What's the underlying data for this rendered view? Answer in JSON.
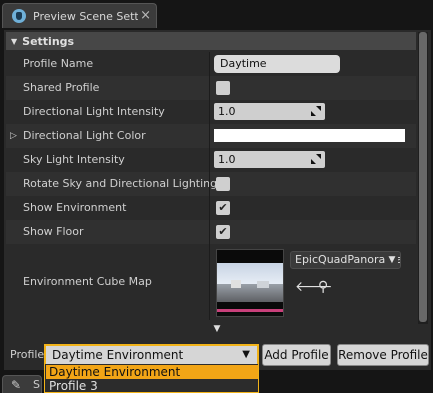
{
  "tab": {
    "title": "Preview Scene Setti",
    "icon": "preview-scene-icon",
    "close_glyph": "×"
  },
  "section": {
    "title": "Settings",
    "expanded_glyph": "▼"
  },
  "rows": {
    "profile_name": {
      "label": "Profile Name",
      "value": "Daytime Environment"
    },
    "shared_profile": {
      "label": "Shared Profile",
      "checked": false
    },
    "dir_light_intensity": {
      "label": "Directional Light Intensity",
      "value": "1.0"
    },
    "dir_light_color": {
      "label": "Directional Light Color",
      "color": "#ffffff",
      "expand_glyph": "▷"
    },
    "sky_light_intensity": {
      "label": "Sky Light Intensity",
      "value": "1.0"
    },
    "rotate_sky": {
      "label": "Rotate Sky and Directional Lighting",
      "checked": false
    },
    "show_environment": {
      "label": "Show Environment",
      "checked": true,
      "check_glyph": "✔"
    },
    "show_floor": {
      "label": "Show Floor",
      "checked": true,
      "check_glyph": "✔"
    },
    "env_cube_map": {
      "label": "Environment Cube Map",
      "asset": "EpicQuadPanorama",
      "caret": "▼",
      "use_glyph": "🡐",
      "browse_glyph": "⚲"
    }
  },
  "more_glyph": "▼",
  "bottom": {
    "profile_label": "Profile",
    "selected_profile": "Daytime Environment",
    "caret": "▼",
    "add_button": "Add Profile",
    "remove_button": "Remove Profile"
  },
  "dropdown": {
    "options": [
      "Daytime Environment",
      "Profile 3"
    ]
  },
  "second_tab": {
    "icon_glyph": "✎",
    "label": "S"
  },
  "colors": {
    "accent": "#f2b319",
    "selection": "#f2a516",
    "panel": "#2a2a2a"
  }
}
